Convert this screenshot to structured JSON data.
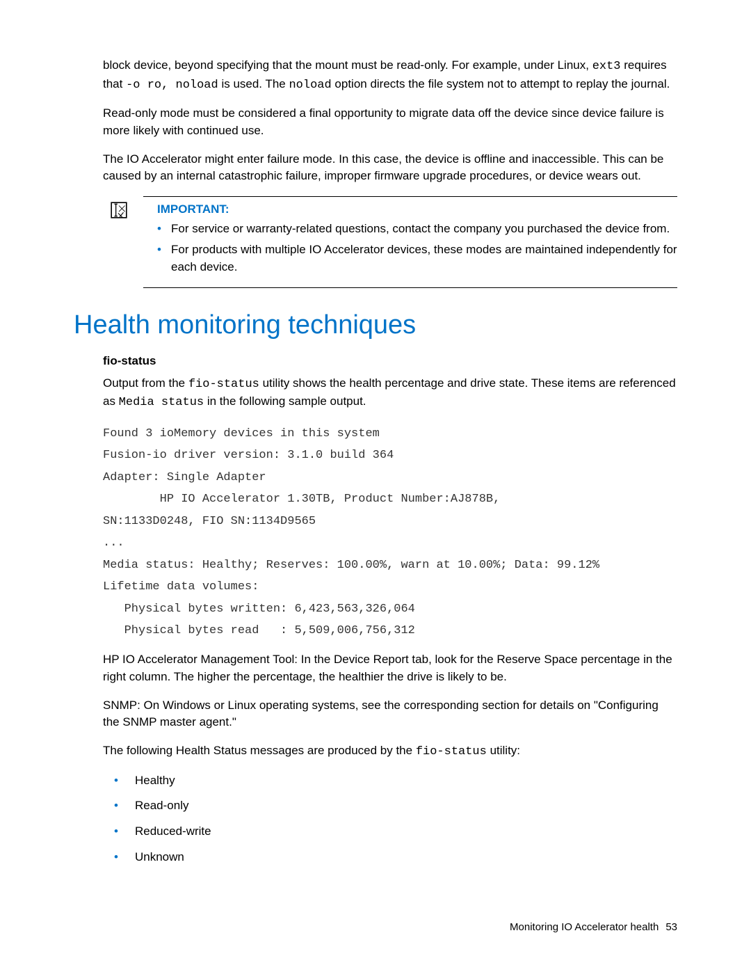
{
  "para1_a": "block device, beyond specifying that the mount must be read-only. For example, under Linux, ",
  "para1_code1": "ext3",
  "para1_b": " requires that ",
  "para1_code2": "-o ro, noload",
  "para1_c": " is used. The ",
  "para1_code3": "noload",
  "para1_d": " option directs the file system not to attempt to replay the journal.",
  "para2": "Read-only mode must be considered a final opportunity to migrate data off the device since device failure is more likely with continued use.",
  "para3": "The IO Accelerator might enter failure mode. In this case, the device is offline and inaccessible. This can be caused by an internal catastrophic failure, improper firmware upgrade procedures, or device wears out.",
  "important_label": "IMPORTANT:",
  "important_items": [
    "For service or warranty-related questions, contact the company you purchased the device from.",
    "For products with multiple IO Accelerator devices, these modes are maintained independently for each device."
  ],
  "heading": "Health monitoring techniques",
  "subhead": "fio-status",
  "para4_a": "Output from the ",
  "para4_code1": "fio-status",
  "para4_b": " utility shows the health percentage and drive state. These items are referenced as ",
  "para4_code2": "Media status",
  "para4_c": " in the following sample output.",
  "mono": "Found 3 ioMemory devices in this system\nFusion-io driver version: 3.1.0 build 364\nAdapter: Single Adapter\n        HP IO Accelerator 1.30TB, Product Number:AJ878B,\nSN:1133D0248, FIO SN:1134D9565\n...\nMedia status: Healthy; Reserves: 100.00%, warn at 10.00%; Data: 99.12%\nLifetime data volumes:\n   Physical bytes written: 6,423,563,326,064\n   Physical bytes read   : 5,509,006,756,312",
  "para5": "HP IO Accelerator Management Tool: In the Device Report tab, look for the Reserve Space percentage in the right column. The higher the percentage, the healthier the drive is likely to be.",
  "para6": "SNMP: On Windows or Linux operating systems, see the corresponding section for details on \"Configuring the SNMP master agent.\"",
  "para7_a": "The following Health Status messages are produced by the ",
  "para7_code1": "fio-status",
  "para7_b": " utility:",
  "status_items": [
    "Healthy",
    "Read-only",
    "Reduced-write",
    "Unknown"
  ],
  "footer_text": "Monitoring IO Accelerator health",
  "footer_page": "53"
}
